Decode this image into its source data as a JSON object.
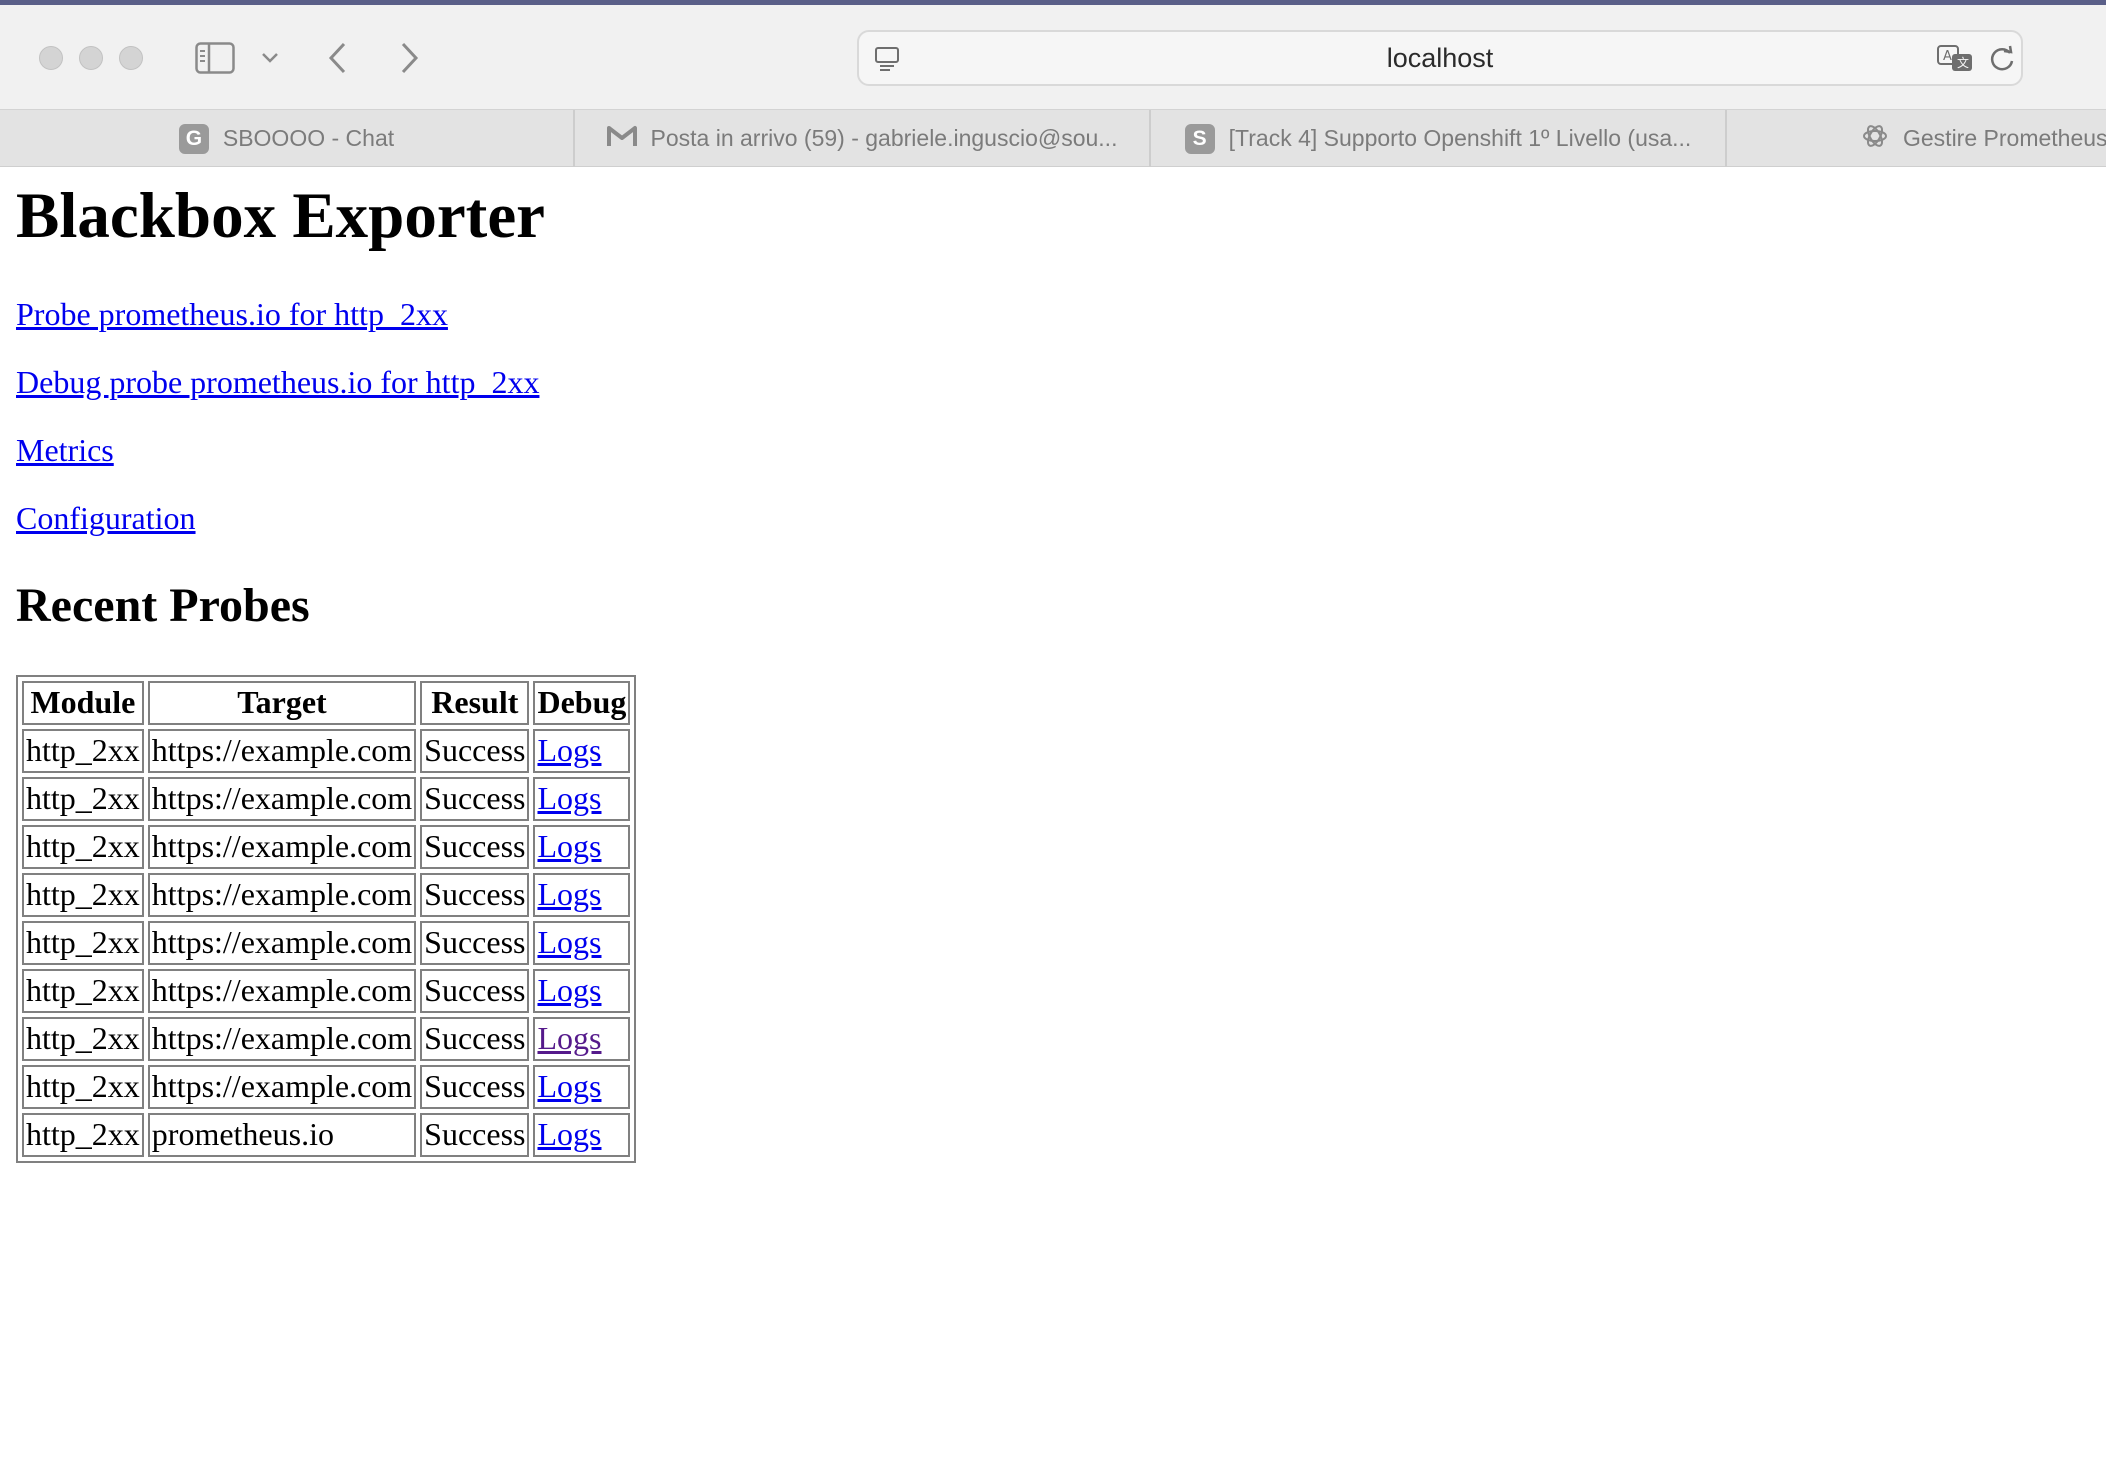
{
  "browser": {
    "url": "localhost",
    "tabs": [
      {
        "favicon": "G",
        "title": "SBOOOO - Chat"
      },
      {
        "favicon": "gmail-icon",
        "title": "Posta in arrivo (59) - gabriele.inguscio@sou..."
      },
      {
        "favicon": "S",
        "title": "[Track 4] Supporto Openshift 1º Livello (usa..."
      },
      {
        "favicon": "openai-icon",
        "title": "Gestire Prometheus"
      }
    ]
  },
  "page": {
    "title": "Blackbox Exporter",
    "links": {
      "probe": "Probe prometheus.io for http_2xx",
      "debug_probe": "Debug probe prometheus.io for http_2xx",
      "metrics": "Metrics",
      "configuration": "Configuration"
    },
    "recent_heading": "Recent Probes",
    "table": {
      "headers": [
        "Module",
        "Target",
        "Result",
        "Debug"
      ],
      "rows": [
        {
          "module": "http_2xx",
          "target": "https://example.com",
          "result": "Success",
          "debug": "Logs",
          "visited": false
        },
        {
          "module": "http_2xx",
          "target": "https://example.com",
          "result": "Success",
          "debug": "Logs",
          "visited": false
        },
        {
          "module": "http_2xx",
          "target": "https://example.com",
          "result": "Success",
          "debug": "Logs",
          "visited": false
        },
        {
          "module": "http_2xx",
          "target": "https://example.com",
          "result": "Success",
          "debug": "Logs",
          "visited": false
        },
        {
          "module": "http_2xx",
          "target": "https://example.com",
          "result": "Success",
          "debug": "Logs",
          "visited": false
        },
        {
          "module": "http_2xx",
          "target": "https://example.com",
          "result": "Success",
          "debug": "Logs",
          "visited": false
        },
        {
          "module": "http_2xx",
          "target": "https://example.com",
          "result": "Success",
          "debug": "Logs",
          "visited": true
        },
        {
          "module": "http_2xx",
          "target": "https://example.com",
          "result": "Success",
          "debug": "Logs",
          "visited": false
        },
        {
          "module": "http_2xx",
          "target": "prometheus.io",
          "result": "Success",
          "debug": "Logs",
          "visited": false
        }
      ]
    }
  },
  "colors": {
    "link": "#0000ee",
    "visited_link": "#551a8b",
    "toolbar_bg": "#f1f1f1",
    "tabbar_bg": "#e3e3e3"
  }
}
